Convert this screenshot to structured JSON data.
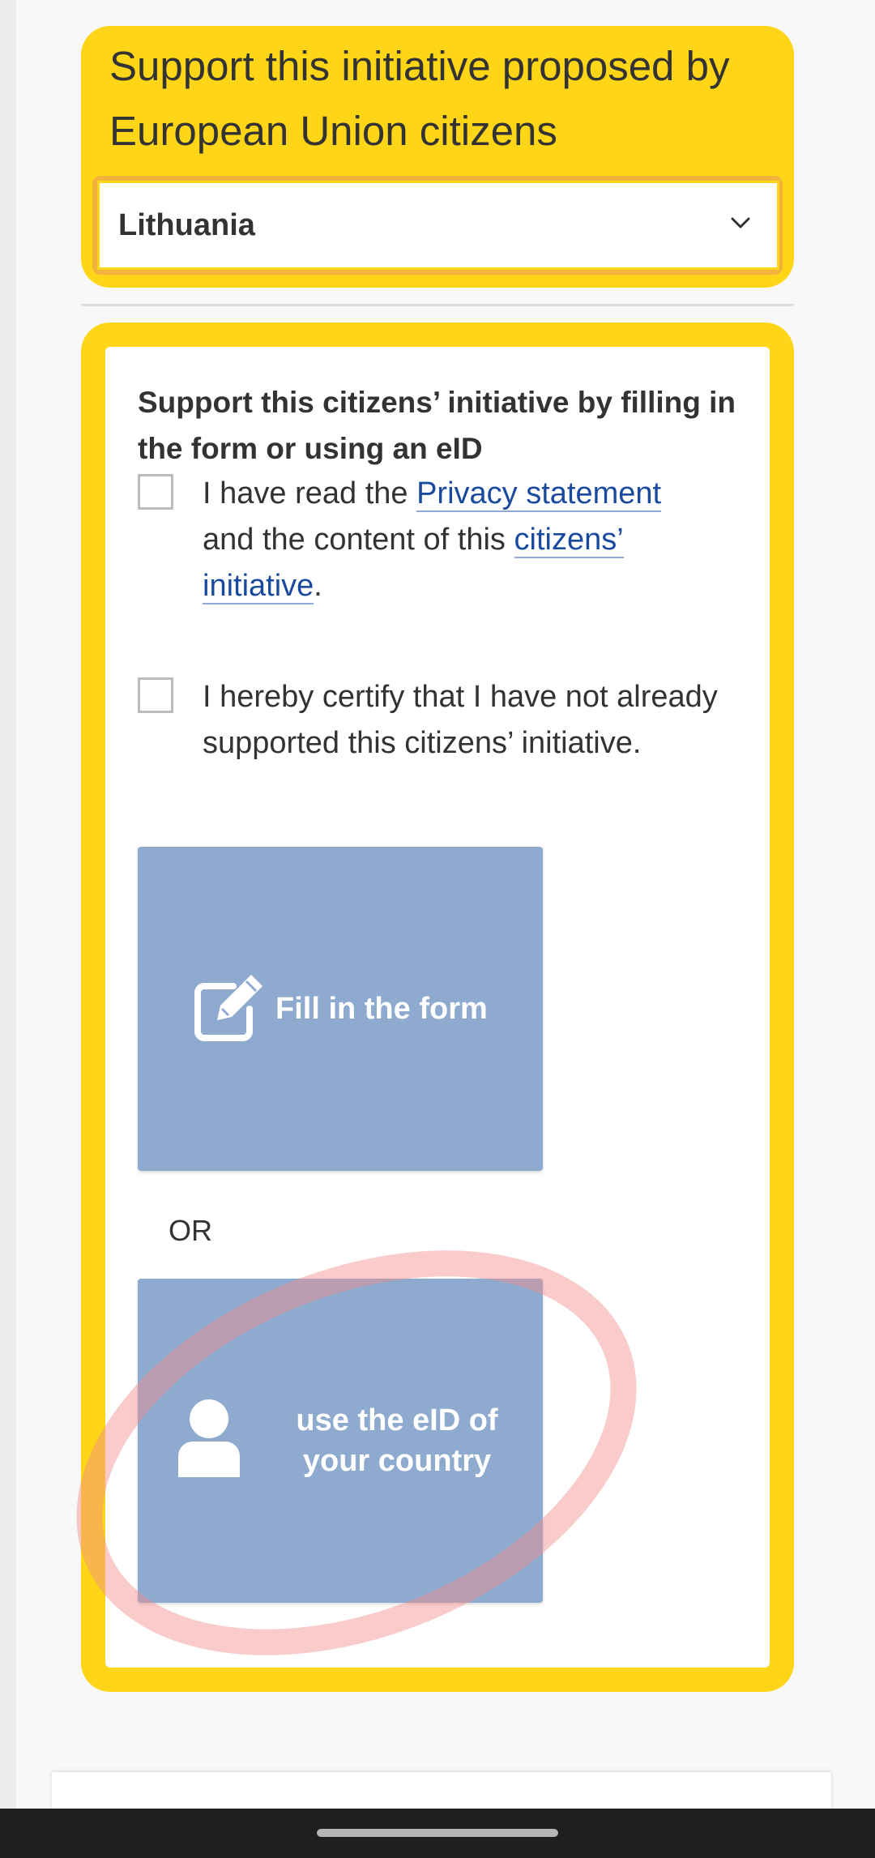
{
  "header": {
    "title": "Support this initiative proposed by European Union citizens",
    "country_select": {
      "value": "Lithuania",
      "icon": "chevron-down-icon"
    }
  },
  "form": {
    "heading": "Support this citizens’ initiative by filling in the form or using an eID",
    "privacy_check": {
      "text_before": "I have read the ",
      "privacy_link": "Privacy statement",
      "text_middle": " and the content of this ",
      "initiative_link": "citizens’ initiative",
      "text_after": "."
    },
    "certify_check": {
      "text": "I hereby certify that I have not already supported this citizens’ initiative."
    },
    "fill_form_button": {
      "label": "Fill in the form",
      "icon": "edit-pencil-icon"
    },
    "or_label": "OR",
    "eid_button": {
      "label_line1": "use the eID of",
      "label_line2": "your country",
      "icon": "user-icon"
    }
  },
  "colors": {
    "accent_yellow": "#ffd617",
    "button_blue": "#8eaacf",
    "link_blue": "#1a4a9e",
    "annotation_red": "#f28b8b"
  }
}
